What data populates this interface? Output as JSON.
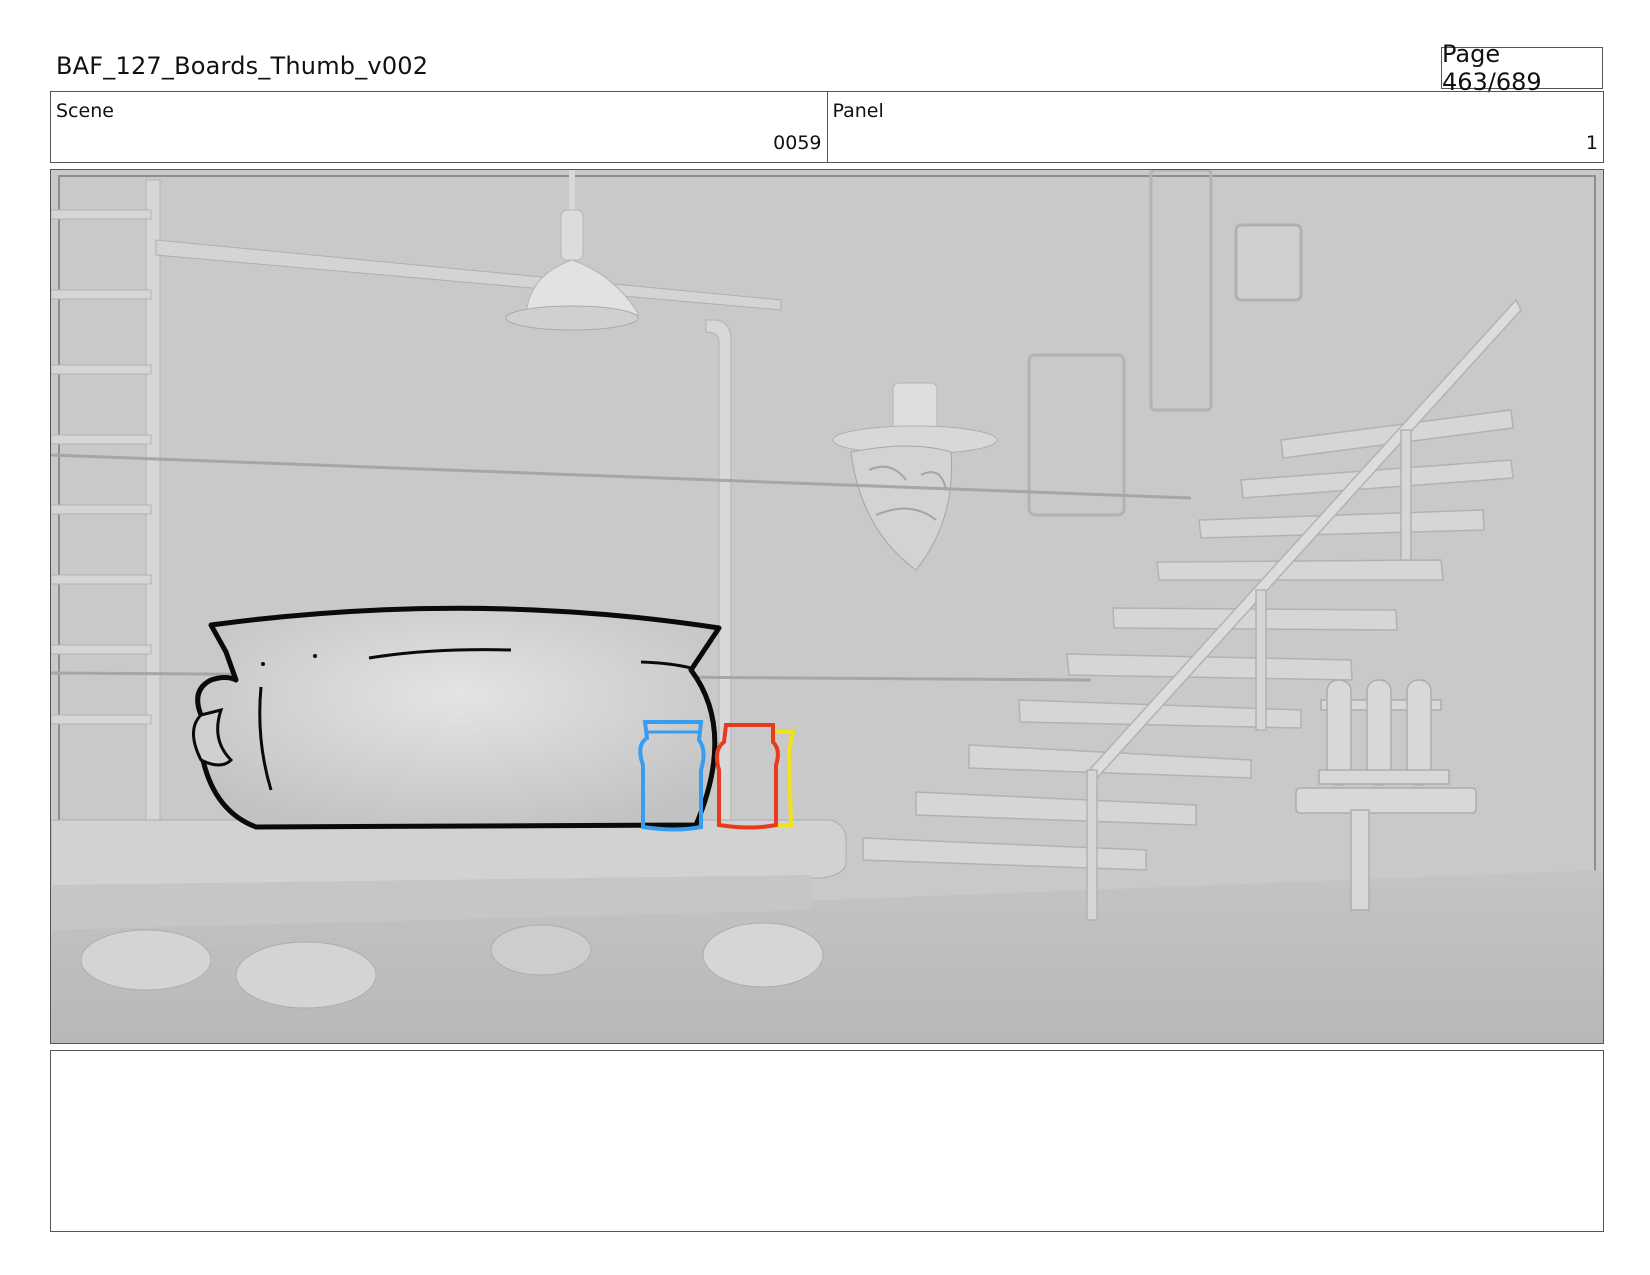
{
  "document": {
    "title": "BAF_127_Boards_Thumb_v002",
    "page_label": "Page 463/689"
  },
  "info": {
    "scene_label": "Scene",
    "scene_value": "0059",
    "panel_label": "Panel",
    "panel_value": "1"
  },
  "notes": {
    "text": ""
  },
  "colors": {
    "jar_blue": "#3a9cf0",
    "jar_red": "#e83a1c",
    "jar_yellow": "#f2e21a",
    "ink": "#0a0a0a"
  }
}
